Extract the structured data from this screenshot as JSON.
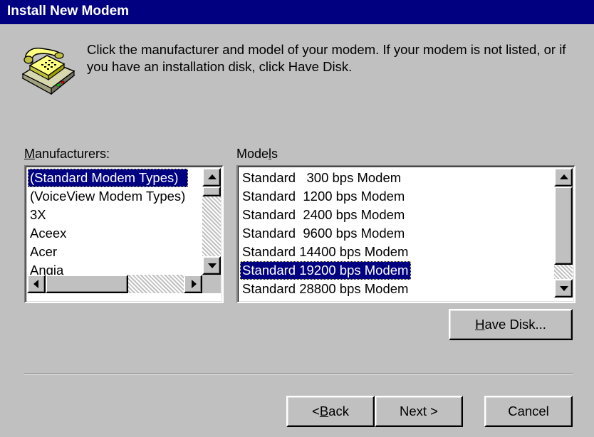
{
  "window": {
    "title": "Install New Modem"
  },
  "instructions": "Click the manufacturer and model of your modem. If your modem is not listed, or if you have an installation disk, click Have Disk.",
  "manufacturers": {
    "label_pre": "",
    "label_accel": "M",
    "label_post": "anufacturers:",
    "items": [
      "(Standard Modem Types)",
      "(VoiceView Modem Types)",
      "3X",
      "Aceex",
      "Acer",
      "Angia"
    ],
    "selected_index": 0
  },
  "models": {
    "label_pre": "Mode",
    "label_accel": "l",
    "label_post": "s",
    "items": [
      "Standard   300 bps Modem",
      "Standard  1200 bps Modem",
      "Standard  2400 bps Modem",
      "Standard  9600 bps Modem",
      "Standard 14400 bps Modem",
      "Standard 19200 bps Modem",
      "Standard 28800 bps Modem"
    ],
    "selected_index": 5
  },
  "buttons": {
    "have_disk_accel": "H",
    "have_disk_rest": "ave Disk...",
    "back_pre": "< ",
    "back_accel": "B",
    "back_rest": "ack",
    "next": "Next >",
    "cancel": "Cancel"
  },
  "icons": {
    "modem": "telephone-modem-icon"
  },
  "colors": {
    "selection": "#000080",
    "titlebar": "#000080",
    "face": "#c0c0c0"
  }
}
